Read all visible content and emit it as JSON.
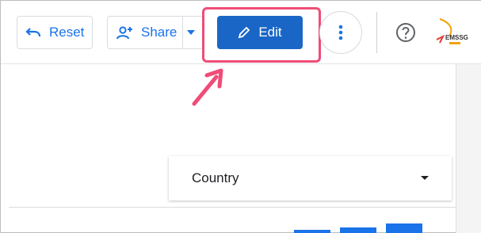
{
  "toolbar": {
    "reset_label": "Reset",
    "share_label": "Share",
    "edit_label": "Edit",
    "logo_text": "EMSSG"
  },
  "filter": {
    "country_label": "Country"
  },
  "colors": {
    "primary": "#1a73e8",
    "edit_button": "#1a66c7",
    "highlight": "#f04c77"
  },
  "icons": [
    "undo-icon",
    "person-add-icon",
    "chevron-down-icon",
    "pencil-icon",
    "more-vert-icon",
    "help-icon",
    "logo-icon",
    "arrow-annotation-icon",
    "dropdown-caret-icon"
  ]
}
